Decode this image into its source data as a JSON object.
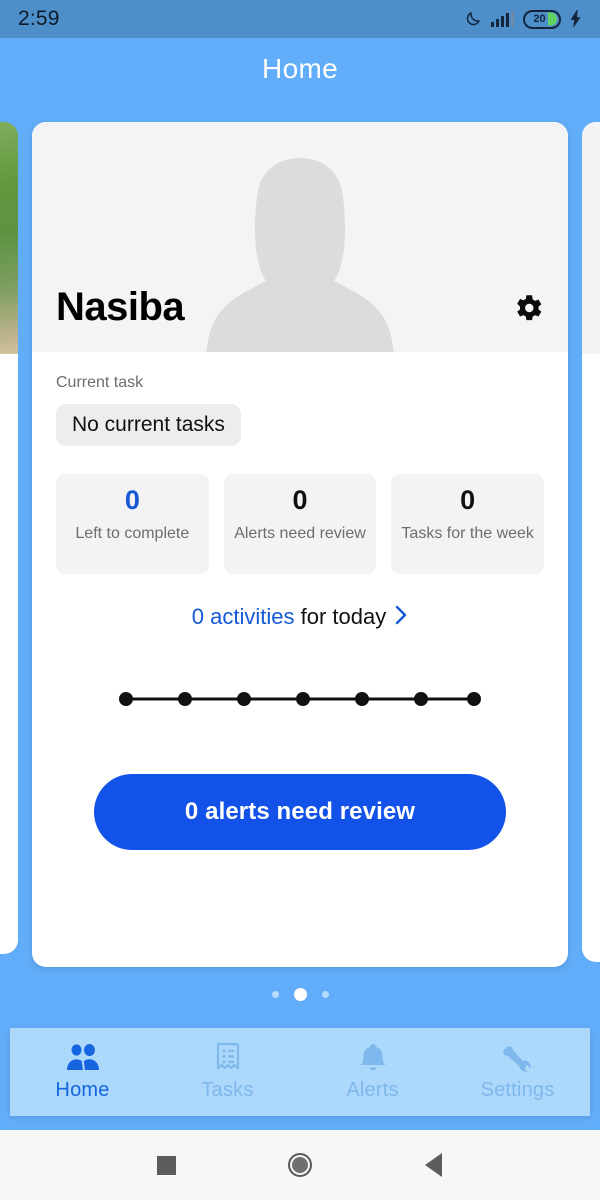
{
  "status_bar": {
    "time": "2:59",
    "battery_percent": "20",
    "icons": [
      "moon-icon",
      "signal-icon",
      "battery-icon",
      "charging-bolt-icon"
    ]
  },
  "header": {
    "title": "Home"
  },
  "profile_card": {
    "name": "Nasiba",
    "avatar": "person-silhouette-avatar",
    "settings_icon": "gear-icon",
    "current_task": {
      "label": "Current task",
      "value": "No current tasks"
    },
    "stats": [
      {
        "value": "0",
        "label": "Left to complete",
        "accent": true
      },
      {
        "value": "0",
        "label": "Alerts need review",
        "accent": false
      },
      {
        "value": "0",
        "label": "Tasks for the week",
        "accent": false
      }
    ],
    "activities": {
      "count_text": "0 activities",
      "suffix_text": " for today",
      "chevron": "chevron-right-icon"
    },
    "timeline": {
      "dots": 7
    },
    "primary_action": "0 alerts need review"
  },
  "carousel": {
    "page_count": 3,
    "active_page": 2
  },
  "bottom_nav": {
    "items": [
      {
        "label": "Home",
        "icon": "people-icon",
        "active": true
      },
      {
        "label": "Tasks",
        "icon": "document-list-icon",
        "active": false
      },
      {
        "label": "Alerts",
        "icon": "bell-icon",
        "active": false
      },
      {
        "label": "Settings",
        "icon": "tools-icon",
        "active": false
      }
    ]
  },
  "system_nav": {
    "recents": "square-icon",
    "home": "circle-icon",
    "back": "triangle-back-icon"
  },
  "colors": {
    "app_background": "#62ADFA",
    "status_bar": "#4E8FC9",
    "accent_blue": "#1558D6",
    "button_blue": "#1352E8",
    "nav_bar": "#ACD8FB",
    "nav_inactive": "#7FB8EC",
    "nav_active": "#1565E0"
  }
}
